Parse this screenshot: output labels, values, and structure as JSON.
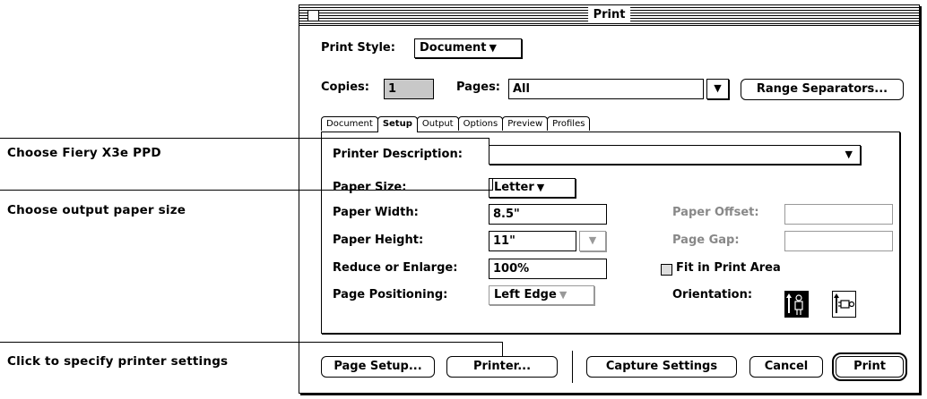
{
  "callouts": {
    "printer_description": "Choose Fiery X3e PPD",
    "paper_size": "Choose output paper size",
    "printer_settings": "Click to specify printer settings"
  },
  "window": {
    "title": "Print"
  },
  "print_style": {
    "label": "Print Style:",
    "value": "Document"
  },
  "copies": {
    "label": "Copies:",
    "value": "1"
  },
  "pages": {
    "label": "Pages:",
    "value": "All"
  },
  "range_separators_label": "Range Separators...",
  "tabs": [
    {
      "label": "Document",
      "active": false
    },
    {
      "label": "Setup",
      "active": true
    },
    {
      "label": "Output",
      "active": false
    },
    {
      "label": "Options",
      "active": false
    },
    {
      "label": "Preview",
      "active": false
    },
    {
      "label": "Profiles",
      "active": false
    }
  ],
  "setup": {
    "printer_description": {
      "label": "Printer Description:",
      "value": ""
    },
    "paper_size": {
      "label": "Paper Size:",
      "value": "Letter"
    },
    "paper_width": {
      "label": "Paper Width:",
      "value": "8.5\""
    },
    "paper_height": {
      "label": "Paper Height:",
      "value": "11\""
    },
    "reduce_enlarge": {
      "label": "Reduce or Enlarge:",
      "value": "100%"
    },
    "page_positioning": {
      "label": "Page Positioning:",
      "value": "Left Edge"
    },
    "paper_offset": {
      "label": "Paper Offset:",
      "value": ""
    },
    "page_gap": {
      "label": "Page Gap:",
      "value": ""
    },
    "fit_in_print_area": {
      "label": "Fit in Print Area",
      "checked": false
    },
    "orientation": {
      "label": "Orientation:",
      "selected": "portrait"
    }
  },
  "buttons": {
    "page_setup": "Page Setup...",
    "printer": "Printer...",
    "capture_settings": "Capture Settings",
    "cancel": "Cancel",
    "print": "Print"
  }
}
